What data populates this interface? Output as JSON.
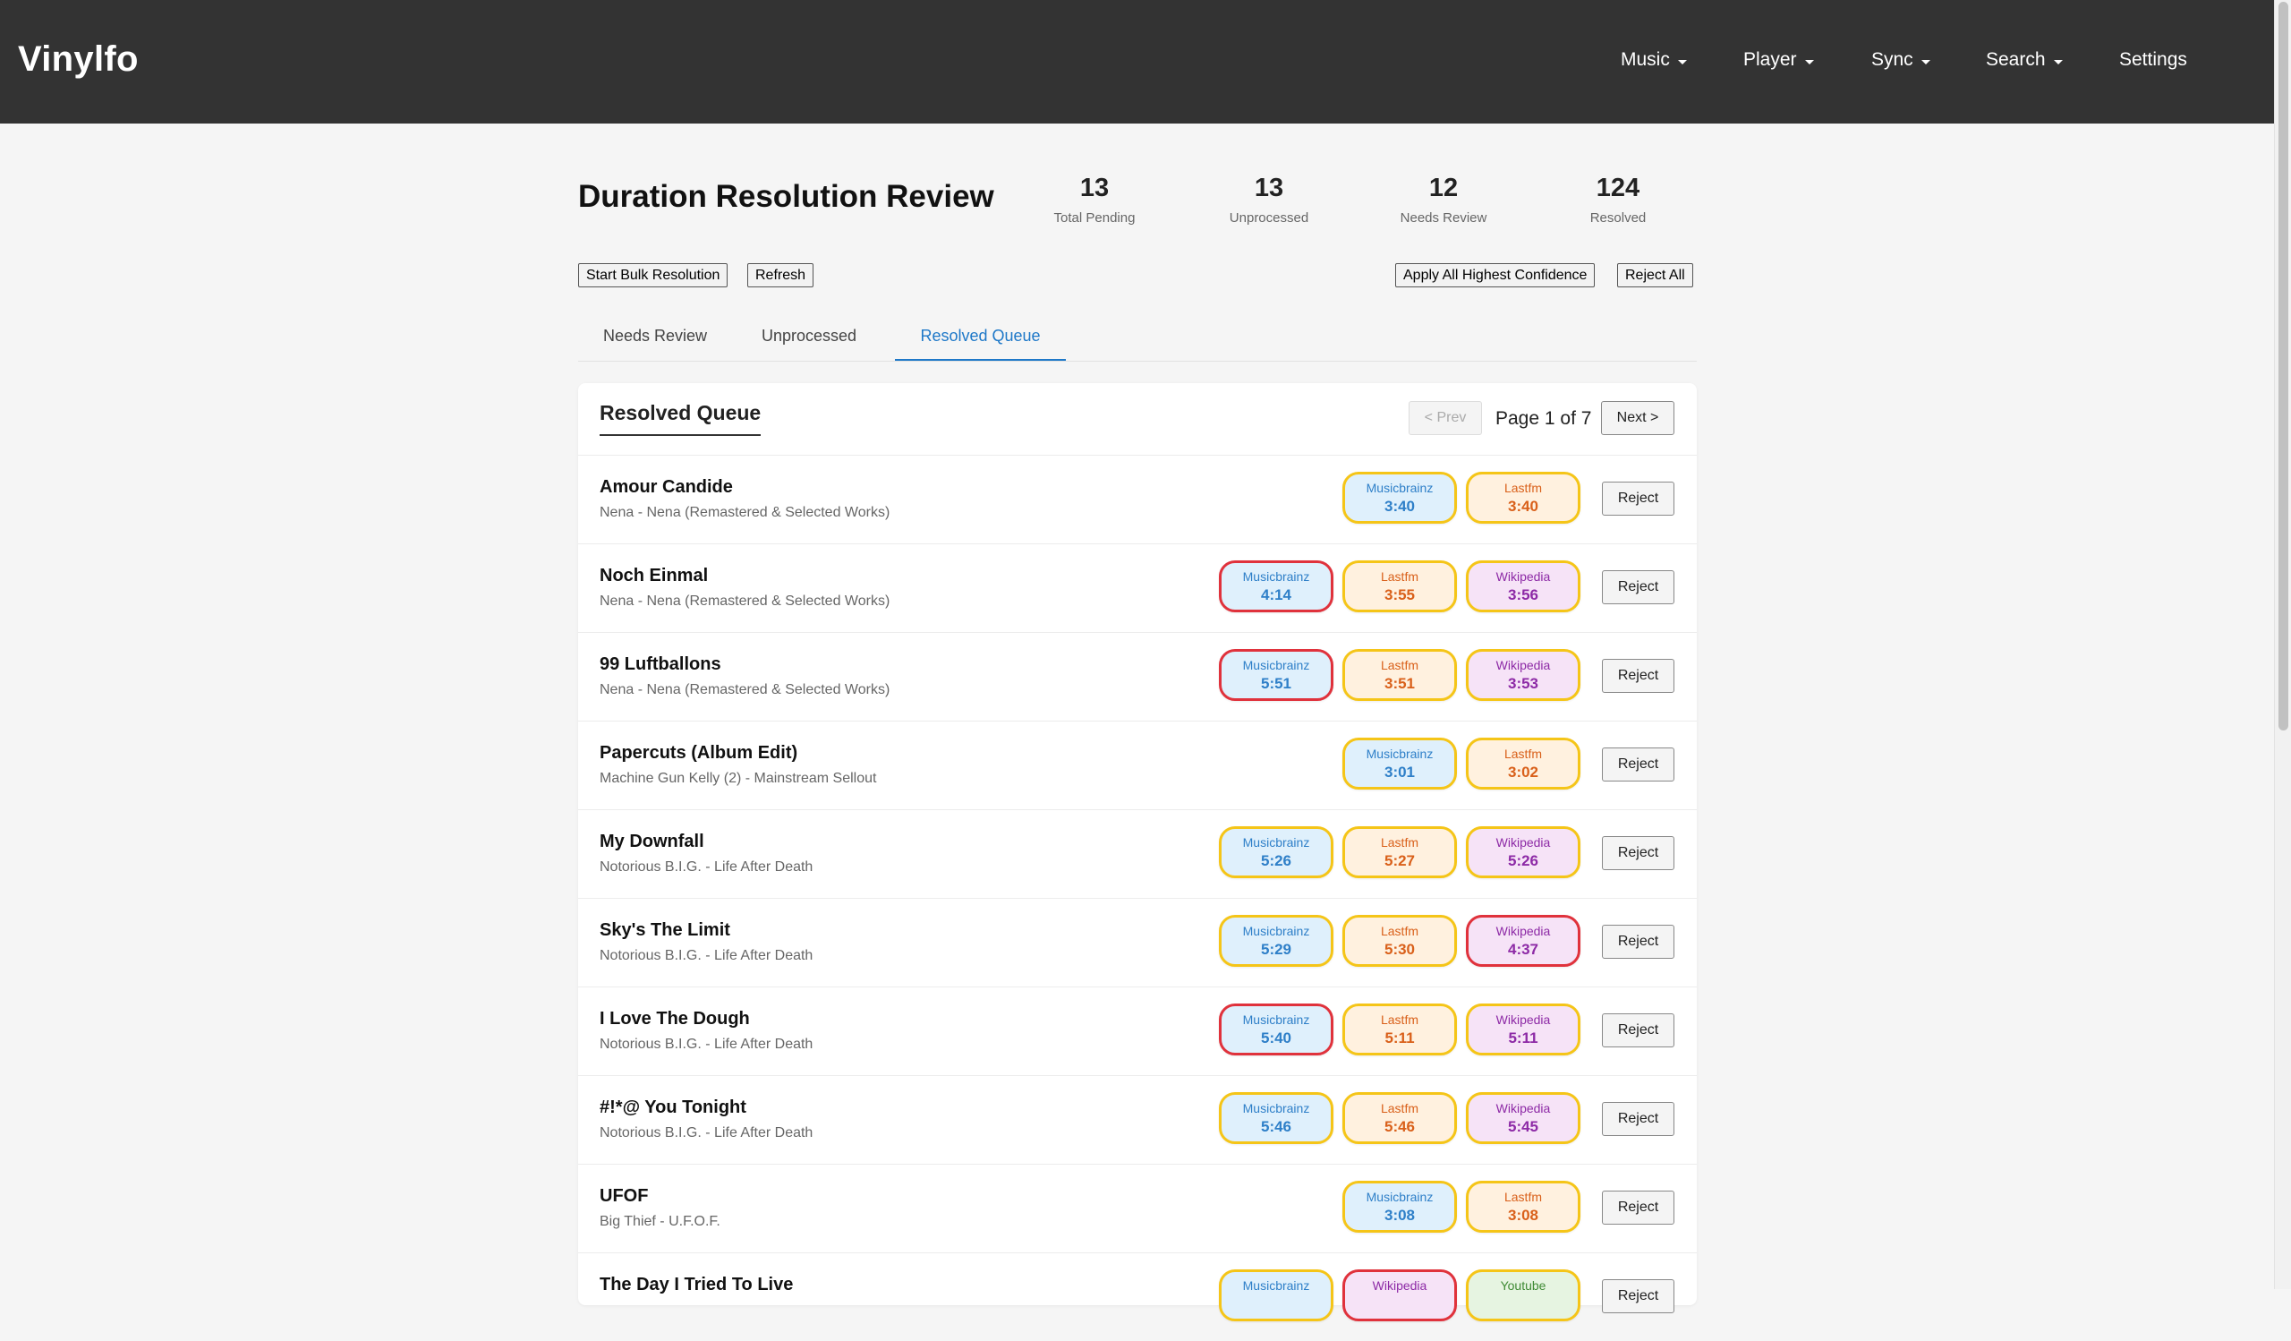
{
  "app": {
    "brand": "Vinylfo"
  },
  "nav": {
    "items": [
      {
        "label": "Music",
        "has_dropdown": true
      },
      {
        "label": "Player",
        "has_dropdown": true
      },
      {
        "label": "Sync",
        "has_dropdown": true
      },
      {
        "label": "Search",
        "has_dropdown": true
      },
      {
        "label": "Settings",
        "has_dropdown": false
      }
    ]
  },
  "page": {
    "title": "Duration Resolution Review",
    "stats": [
      {
        "value": "13",
        "label": "Total Pending"
      },
      {
        "value": "13",
        "label": "Unprocessed"
      },
      {
        "value": "12",
        "label": "Needs Review"
      },
      {
        "value": "124",
        "label": "Resolved"
      }
    ],
    "actions": {
      "start_bulk": "Start Bulk Resolution",
      "refresh": "Refresh",
      "apply_all": "Apply All Highest Confidence",
      "reject_all": "Reject All"
    },
    "tabs": [
      {
        "label": "Needs Review",
        "active": false
      },
      {
        "label": "Unprocessed",
        "active": false
      },
      {
        "label": "Resolved Queue",
        "active": true
      }
    ]
  },
  "queue": {
    "title": "Resolved Queue",
    "prev_label": "< Prev",
    "page_text": "Page 1 of 7",
    "next_label": "Next >",
    "reject_label": "Reject",
    "rows": [
      {
        "title": "Amour Candide",
        "subtitle": "Nena - Nena (Remastered & Selected Works)",
        "sources": [
          {
            "name": "Musicbrainz",
            "duration": "3:40",
            "type": "musicbrainz",
            "disputed": false
          },
          {
            "name": "Lastfm",
            "duration": "3:40",
            "type": "lastfm",
            "disputed": false
          }
        ]
      },
      {
        "title": "Noch Einmal",
        "subtitle": "Nena - Nena (Remastered & Selected Works)",
        "sources": [
          {
            "name": "Musicbrainz",
            "duration": "4:14",
            "type": "musicbrainz",
            "disputed": true
          },
          {
            "name": "Lastfm",
            "duration": "3:55",
            "type": "lastfm",
            "disputed": false
          },
          {
            "name": "Wikipedia",
            "duration": "3:56",
            "type": "wikipedia",
            "disputed": false
          }
        ]
      },
      {
        "title": "99 Luftballons",
        "subtitle": "Nena - Nena (Remastered & Selected Works)",
        "sources": [
          {
            "name": "Musicbrainz",
            "duration": "5:51",
            "type": "musicbrainz",
            "disputed": true
          },
          {
            "name": "Lastfm",
            "duration": "3:51",
            "type": "lastfm",
            "disputed": false
          },
          {
            "name": "Wikipedia",
            "duration": "3:53",
            "type": "wikipedia",
            "disputed": false
          }
        ]
      },
      {
        "title": "Papercuts (Album Edit)",
        "subtitle": "Machine Gun Kelly (2) - Mainstream Sellout",
        "sources": [
          {
            "name": "Musicbrainz",
            "duration": "3:01",
            "type": "musicbrainz",
            "disputed": false
          },
          {
            "name": "Lastfm",
            "duration": "3:02",
            "type": "lastfm",
            "disputed": false
          }
        ]
      },
      {
        "title": "My Downfall",
        "subtitle": "Notorious B.I.G. - Life After Death",
        "sources": [
          {
            "name": "Musicbrainz",
            "duration": "5:26",
            "type": "musicbrainz",
            "disputed": false
          },
          {
            "name": "Lastfm",
            "duration": "5:27",
            "type": "lastfm",
            "disputed": false
          },
          {
            "name": "Wikipedia",
            "duration": "5:26",
            "type": "wikipedia",
            "disputed": false
          }
        ]
      },
      {
        "title": "Sky's The Limit",
        "subtitle": "Notorious B.I.G. - Life After Death",
        "sources": [
          {
            "name": "Musicbrainz",
            "duration": "5:29",
            "type": "musicbrainz",
            "disputed": false
          },
          {
            "name": "Lastfm",
            "duration": "5:30",
            "type": "lastfm",
            "disputed": false
          },
          {
            "name": "Wikipedia",
            "duration": "4:37",
            "type": "wikipedia",
            "disputed": true
          }
        ]
      },
      {
        "title": "I Love The Dough",
        "subtitle": "Notorious B.I.G. - Life After Death",
        "sources": [
          {
            "name": "Musicbrainz",
            "duration": "5:40",
            "type": "musicbrainz",
            "disputed": true
          },
          {
            "name": "Lastfm",
            "duration": "5:11",
            "type": "lastfm",
            "disputed": false
          },
          {
            "name": "Wikipedia",
            "duration": "5:11",
            "type": "wikipedia",
            "disputed": false
          }
        ]
      },
      {
        "title": "#!*@ You Tonight",
        "subtitle": "Notorious B.I.G. - Life After Death",
        "sources": [
          {
            "name": "Musicbrainz",
            "duration": "5:46",
            "type": "musicbrainz",
            "disputed": false
          },
          {
            "name": "Lastfm",
            "duration": "5:46",
            "type": "lastfm",
            "disputed": false
          },
          {
            "name": "Wikipedia",
            "duration": "5:45",
            "type": "wikipedia",
            "disputed": false
          }
        ]
      },
      {
        "title": "UFOF",
        "subtitle": "Big Thief - U.F.O.F.",
        "sources": [
          {
            "name": "Musicbrainz",
            "duration": "3:08",
            "type": "musicbrainz",
            "disputed": false
          },
          {
            "name": "Lastfm",
            "duration": "3:08",
            "type": "lastfm",
            "disputed": false
          }
        ]
      },
      {
        "title": "The Day I Tried To Live",
        "subtitle": "",
        "sources": [
          {
            "name": "Musicbrainz",
            "duration": "",
            "type": "musicbrainz",
            "disputed": false
          },
          {
            "name": "Wikipedia",
            "duration": "",
            "type": "wikipedia",
            "disputed": true
          },
          {
            "name": "Youtube",
            "duration": "",
            "type": "youtube",
            "disputed": false
          }
        ]
      }
    ]
  },
  "colors": {
    "navbar": "#333333",
    "accent": "#1e78c8",
    "confirmed_border": "#f5c518",
    "disputed_border": "#e0323c",
    "musicbrainz": "#2e7fc8",
    "lastfm": "#d9601a",
    "wikipedia": "#8d2aa6",
    "youtube": "#3f8a34"
  }
}
